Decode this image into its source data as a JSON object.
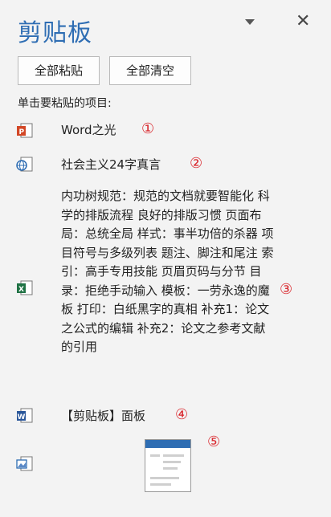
{
  "pane": {
    "title": "剪贴板",
    "close_glyph": "✕",
    "paste_all": "全部粘贴",
    "clear_all": "全部清空",
    "hint": "单击要粘贴的项目:"
  },
  "items": [
    {
      "icon": "powerpoint-icon",
      "text": "Word之光",
      "marker": "①"
    },
    {
      "icon": "web-icon",
      "text": "社会主义24字真言",
      "marker": "②"
    },
    {
      "icon": "excel-icon",
      "text": "内功树规范：规范的文档就要智能化 科学的排版流程 良好的排版习惯 页面布局：总统全局 样式：事半功倍的杀器 项目符号与多级列表 题注、脚注和尾注 索引：高手专用技能 页眉页码与分节 目录：拒绝手动输入 模板：一劳永逸的魔板 打印：白纸黑字的真相 补充1：论文之公式的编辑 补充2：论文之参考文献的引用",
      "marker": "③"
    },
    {
      "icon": "word-icon",
      "text": "【剪贴板】面板",
      "marker": "④"
    },
    {
      "icon": "image-icon",
      "text": "",
      "marker": "⑤"
    }
  ],
  "colors": {
    "title": "#2e6db3",
    "marker": "#d9262c",
    "background": "#f3f3f3"
  }
}
